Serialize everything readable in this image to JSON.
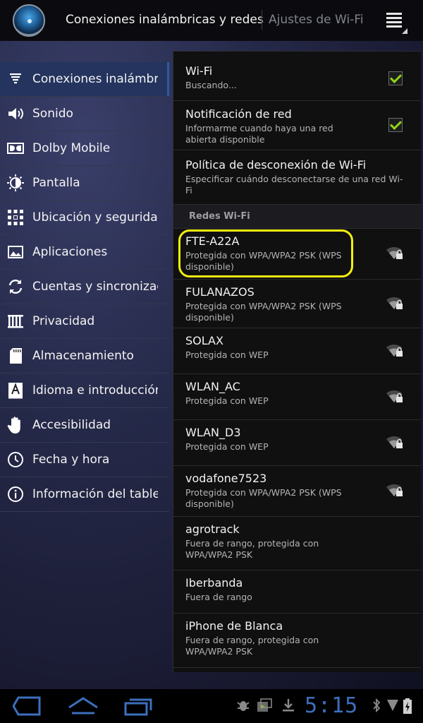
{
  "action_bar": {
    "title": "Conexiones inalámbricas y redes",
    "subtitle": "Ajustes de Wi-Fi"
  },
  "sidebar": {
    "items": [
      {
        "label": "Conexiones inalámbr",
        "icon": "wireless-icon",
        "active": true
      },
      {
        "label": "Sonido",
        "icon": "speaker-icon"
      },
      {
        "label": "Dolby Mobile",
        "icon": "dolby-icon"
      },
      {
        "label": "Pantalla",
        "icon": "brightness-icon"
      },
      {
        "label": "Ubicación y seguridad",
        "icon": "location-grid-icon"
      },
      {
        "label": "Aplicaciones",
        "icon": "applications-icon"
      },
      {
        "label": "Cuentas y sincronización",
        "icon": "sync-icon"
      },
      {
        "label": "Privacidad",
        "icon": "privacy-icon"
      },
      {
        "label": "Almacenamiento",
        "icon": "sd-card-icon"
      },
      {
        "label": "Idioma e introducción",
        "icon": "language-icon"
      },
      {
        "label": "Accesibilidad",
        "icon": "hand-icon"
      },
      {
        "label": "Fecha y hora",
        "icon": "clock-icon"
      },
      {
        "label": "Información del tablet",
        "icon": "info-icon"
      }
    ]
  },
  "settings": {
    "wifi": {
      "title": "Wi-Fi",
      "summary": "Buscando...",
      "checked": true
    },
    "notification": {
      "title": "Notificación de red",
      "summary": "Informarme cuando haya una red abierta disponible",
      "checked": true
    },
    "disconnect_policy": {
      "title": "Política de desconexión de Wi-Fi",
      "summary": "Especificar cuándo desconectarse de una red Wi-Fi"
    }
  },
  "networks_header": "Redes Wi-Fi",
  "networks": [
    {
      "ssid": "FTE-A22A",
      "status": "Protegida con WPA/WPA2 PSK (WPS disponible)",
      "signal_icon": "wifi-locked-icon",
      "highlighted": true
    },
    {
      "ssid": "FULANAZOS",
      "status": "Protegida con WPA/WPA2 PSK (WPS disponible)",
      "signal_icon": "wifi-locked-icon"
    },
    {
      "ssid": "SOLAX",
      "status": "Protegida con WEP",
      "signal_icon": "wifi-locked-icon"
    },
    {
      "ssid": "WLAN_AC",
      "status": "Protegida con WEP",
      "signal_icon": "wifi-locked-icon"
    },
    {
      "ssid": "WLAN_D3",
      "status": "Protegida con WEP",
      "signal_icon": "wifi-locked-icon"
    },
    {
      "ssid": "vodafone7523",
      "status": "Protegida con WPA/WPA2 PSK (WPS disponible)",
      "signal_icon": "wifi-locked-icon"
    },
    {
      "ssid": "agrotrack",
      "status": "Fuera de rango, protegida con WPA/WPA2 PSK",
      "signal_icon": ""
    },
    {
      "ssid": "Iberbanda",
      "status": "Fuera de rango",
      "signal_icon": ""
    },
    {
      "ssid": "iPhone de Blanca",
      "status": "Fuera de rango, protegida con WPA/WPA2 PSK",
      "signal_icon": ""
    }
  ],
  "system_bar": {
    "clock": "5:15",
    "nav_icons": [
      "back-icon",
      "home-icon",
      "recent-apps-icon"
    ],
    "status_icons": [
      "debug-icon",
      "media-icon",
      "download-icon",
      "bluetooth-icon",
      "signal-icon",
      "battery-charging-icon"
    ]
  },
  "colors": {
    "accent_check": "#8fd41a",
    "highlight_outline": "#f3ef10",
    "clock": "#3c6fbe",
    "sidebar_active": "#24345e"
  }
}
